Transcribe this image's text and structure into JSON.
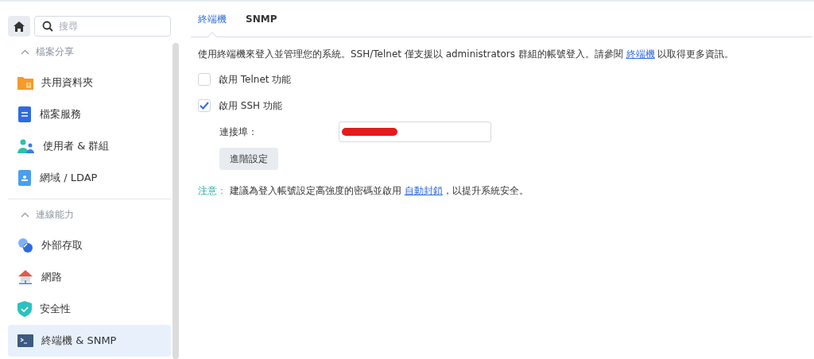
{
  "sidebar": {
    "search": {
      "placeholder": "搜尋"
    },
    "sections": [
      {
        "title": "檔案分享",
        "expanded": true,
        "items": [
          {
            "label": "共用資料夾",
            "selected": false
          },
          {
            "label": "檔案服務",
            "selected": false
          },
          {
            "label": "使用者 & 群組",
            "selected": false
          },
          {
            "label": "網域 / LDAP",
            "selected": false
          }
        ]
      },
      {
        "title": "連線能力",
        "expanded": true,
        "items": [
          {
            "label": "外部存取",
            "selected": false
          },
          {
            "label": "網路",
            "selected": false
          },
          {
            "label": "安全性",
            "selected": false
          },
          {
            "label": "終端機 & SNMP",
            "selected": true
          }
        ]
      }
    ]
  },
  "tabs": [
    {
      "label": "終端機",
      "selected": true
    },
    {
      "label": "SNMP",
      "selected": false
    }
  ],
  "intro": {
    "before": "使用終端機來登入並管理您的系統。SSH/Telnet 僅支援以 administrators 群組的帳號登入。請參閱",
    "link": "終端機",
    "after": "以取得更多資訊。"
  },
  "options": [
    {
      "label": "啟用 Telnet 功能",
      "checked": false
    },
    {
      "label": "啟用 SSH 功能",
      "checked": true
    }
  ],
  "port": {
    "label": "連接埠：",
    "redacted": true
  },
  "advanced_button": "進階設定",
  "note": {
    "label": "注意：",
    "before": "建議為登入帳號設定高強度的密碼並啟用",
    "link": "自動封鎖",
    "after": "，以提升系統安全。"
  }
}
